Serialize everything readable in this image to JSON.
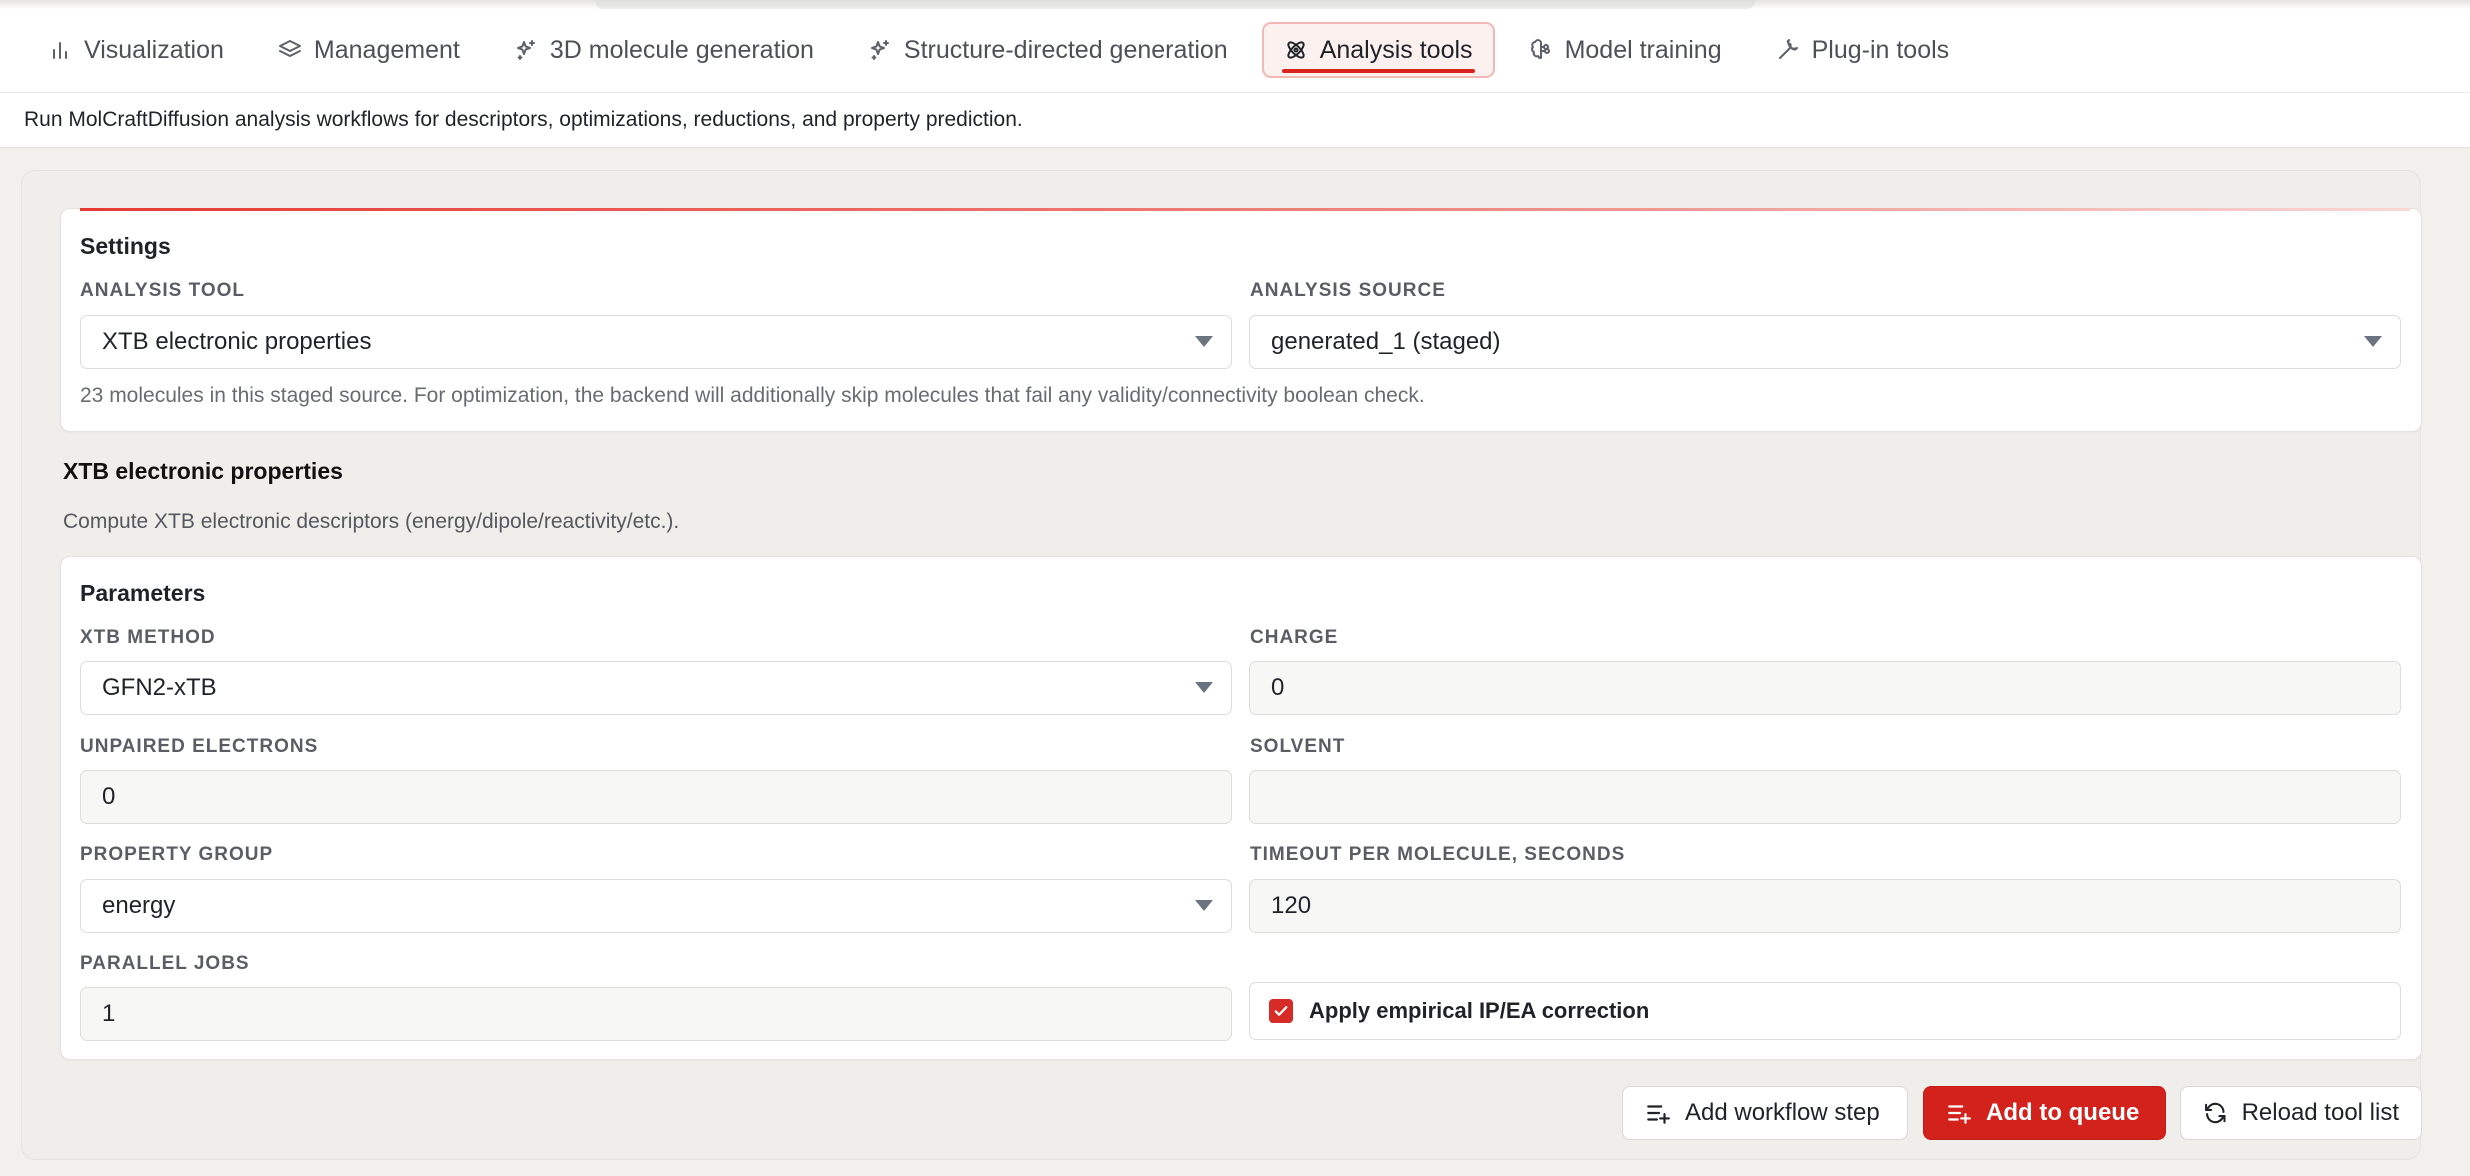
{
  "tabs": [
    {
      "label": "Visualization",
      "icon": "bar-chart-icon"
    },
    {
      "label": "Management",
      "icon": "layers-icon"
    },
    {
      "label": "3D molecule generation",
      "icon": "sparkle-icon"
    },
    {
      "label": "Structure-directed generation",
      "icon": "sparkle-icon"
    },
    {
      "label": "Analysis tools",
      "icon": "atom-icon",
      "active": true
    },
    {
      "label": "Model training",
      "icon": "brain-icon"
    },
    {
      "label": "Plug-in tools",
      "icon": "wrench-icon"
    }
  ],
  "description": "Run MolCraftDiffusion analysis workflows for descriptors, optimizations, reductions, and property prediction.",
  "settings": {
    "title": "Settings",
    "analysis_tool_label": "ANALYSIS TOOL",
    "analysis_tool_value": "XTB electronic properties",
    "analysis_source_label": "ANALYSIS SOURCE",
    "analysis_source_value": "generated_1 (staged)",
    "hint": "23 molecules in this staged source. For optimization, the backend will additionally skip molecules that fail any validity/connectivity boolean check."
  },
  "tool": {
    "title": "XTB electronic properties",
    "description": "Compute XTB electronic descriptors (energy/dipole/reactivity/etc.)."
  },
  "parameters": {
    "title": "Parameters",
    "xtb_method_label": "XTB METHOD",
    "xtb_method_value": "GFN2-xTB",
    "charge_label": "CHARGE",
    "charge_value": "0",
    "unpaired_label": "UNPAIRED ELECTRONS",
    "unpaired_value": "0",
    "solvent_label": "SOLVENT",
    "solvent_value": "",
    "property_group_label": "PROPERTY GROUP",
    "property_group_value": "energy",
    "timeout_label": "TIMEOUT PER MOLECULE, SECONDS",
    "timeout_value": "120",
    "parallel_label": "PARALLEL JOBS",
    "parallel_value": "1",
    "correction_label": "Apply empirical IP/EA correction",
    "correction_checked": true
  },
  "actions": {
    "add_step": "Add workflow step",
    "add_queue": "Add to queue",
    "reload": "Reload tool list"
  },
  "colors": {
    "accent": "#d3211c",
    "active_tab_bg": "#fdf1f0",
    "page_bg": "#f1f0ed"
  }
}
